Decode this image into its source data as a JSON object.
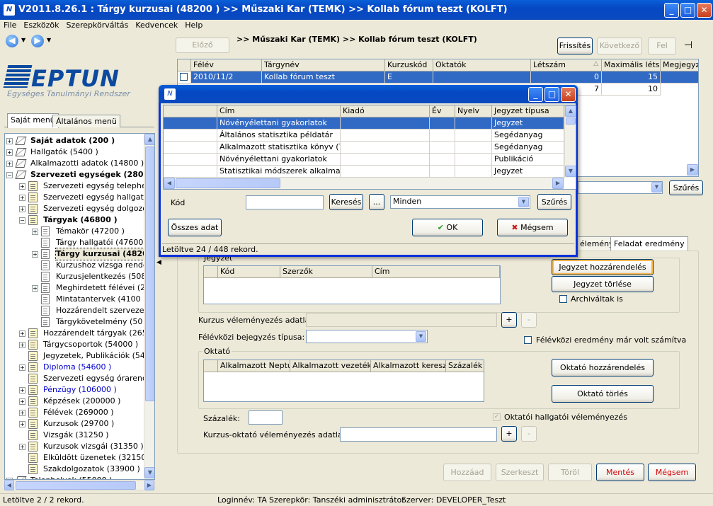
{
  "window": {
    "title": "V2011.8.26.1 : Tárgy kurzusai (48200  )  >> Műszaki Kar (TEMK) >> Kollab fórum teszt (KOLFT)",
    "min": "_",
    "max": "□",
    "close": "✕"
  },
  "menu": [
    "File",
    "Eszközök",
    "Szerepkörváltás",
    "Kedvencek",
    "Help"
  ],
  "logo": {
    "name": "NEPTUN",
    "subtitle": "Egységes Tanulmányi Rendszer"
  },
  "left_tabs": [
    "Saját menü",
    "Általános menü"
  ],
  "tree": [
    {
      "label": "Saját adatok (200  )",
      "bold": true,
      "level": 0,
      "sign": "+",
      "icon": "book"
    },
    {
      "label": "Hallgatók (5400  )",
      "level": 0,
      "sign": "+",
      "icon": "book"
    },
    {
      "label": "Alkalmazotti adatok (14800  )",
      "level": 0,
      "sign": "+",
      "icon": "book"
    },
    {
      "label": "Szervezeti egységek (28000",
      "bold": true,
      "level": 0,
      "sign": "-",
      "icon": "book"
    },
    {
      "label": "Szervezeti egység telephelyei",
      "level": 1,
      "sign": "+",
      "icon": "docs"
    },
    {
      "label": "Szervezeti egység hallgatói (2",
      "level": 1,
      "sign": "+",
      "icon": "docs"
    },
    {
      "label": "Szervezeti egység dolgozói (2",
      "level": 1,
      "sign": "+",
      "icon": "docs"
    },
    {
      "label": "Tárgyak (46800  )",
      "bold": true,
      "level": 1,
      "sign": "-",
      "icon": "docs"
    },
    {
      "label": "Témakör (47200  )",
      "level": 2,
      "sign": "+",
      "icon": "doc"
    },
    {
      "label": "Tárgy hallgatói (47600  )",
      "level": 2,
      "sign": "",
      "icon": "doc"
    },
    {
      "label": "Tárgy kurzusai (4820",
      "bold": true,
      "level": 2,
      "sign": "+",
      "icon": "doc"
    },
    {
      "label": "Kurzushoz vizsga rendelé",
      "level": 2,
      "sign": "",
      "icon": "doc"
    },
    {
      "label": "Kurzusjelentkezés (50800",
      "level": 2,
      "sign": "",
      "icon": "doc"
    },
    {
      "label": "Meghirdetett félévei (2684",
      "level": 2,
      "sign": "+",
      "icon": "doc"
    },
    {
      "label": "Mintatantervek (4100  )",
      "level": 2,
      "sign": "",
      "icon": "doc"
    },
    {
      "label": "Hozzárendelt szervezeti e",
      "level": 2,
      "sign": "",
      "icon": "doc"
    },
    {
      "label": "Tárgykövetelmény (50",
      "level": 2,
      "sign": "",
      "icon": "doc"
    },
    {
      "label": "Hozzárendelt tárgyak (2650  )",
      "level": 1,
      "sign": "+",
      "icon": "docs"
    },
    {
      "label": "Tárgycsoportok (54000  )",
      "level": 1,
      "sign": "+",
      "icon": "docs"
    },
    {
      "label": "Jegyzetek, Publikációk (5440",
      "level": 1,
      "sign": "",
      "icon": "docs"
    },
    {
      "label": "Diploma (54600  )",
      "level": 1,
      "sign": "+",
      "icon": "docs",
      "blue": true
    },
    {
      "label": "Szervezeti egység órarendje (",
      "level": 1,
      "sign": "",
      "icon": "docs"
    },
    {
      "label": "Pénzügy (106000  )",
      "level": 1,
      "sign": "+",
      "icon": "docs",
      "blue": true
    },
    {
      "label": "Képzések (200000  )",
      "level": 1,
      "sign": "+",
      "icon": "docs"
    },
    {
      "label": "Félévek (269000  )",
      "level": 1,
      "sign": "+",
      "icon": "docs"
    },
    {
      "label": "Kurzusok (29700  )",
      "level": 1,
      "sign": "+",
      "icon": "docs"
    },
    {
      "label": "Vizsgák (31250  )",
      "level": 1,
      "sign": "",
      "icon": "docs"
    },
    {
      "label": "Kurzusok vizsgái (31350  )",
      "level": 1,
      "sign": "+",
      "icon": "docs"
    },
    {
      "label": "Elküldött üzenetek (32150  )",
      "level": 1,
      "sign": "",
      "icon": "docs"
    },
    {
      "label": "Szakdolgozatok (33900  )",
      "level": 1,
      "sign": "",
      "icon": "docs"
    },
    {
      "label": "Telephelyek (55000  )",
      "level": 0,
      "sign": "+",
      "icon": "book"
    }
  ],
  "toolbar": {
    "prev": "Előző",
    "breadcrumb": ">> Műszaki Kar (TEMK) >> Kollab fórum teszt (KOLFT)",
    "refresh": "Frissítés",
    "next": "Következő",
    "up": "Fel",
    "pin": "⊣"
  },
  "main_grid": {
    "columns": [
      "Félév",
      "Tárgynév",
      "Kurzuskód",
      "Oktatók",
      "Létszám",
      "Maximális létsz...",
      "Megjegyzé"
    ],
    "rows": [
      [
        "2010/11/2",
        "Kollab fórum teszt",
        "E",
        "",
        "0",
        "15",
        ""
      ],
      [
        "",
        "",
        "",
        "",
        "7",
        "10",
        ""
      ]
    ]
  },
  "right_filter": {
    "filter_btn": "Szűrés"
  },
  "detail_tabs": [
    "éleménylista",
    "Feladat eredmény"
  ],
  "detail": {
    "jegyzet_group": "Jegyzet",
    "jegyzet_columns": [
      "Kód",
      "Szerzők",
      "Cím"
    ],
    "assign_note": "Jegyzet hozzárendelés",
    "delete_note": "Jegyzet törlése",
    "archived": "Archiváltak is",
    "course_eval_label": "Kurzus véleményezés adatlapja:",
    "plus": "+",
    "minus": "-",
    "midterm_label": "Félévközi bejegyzés típusa:",
    "midterm_calculated": "Félévközi eredmény már volt számítva",
    "teacher_group": "Oktató",
    "teacher_columns": [
      "Alkalmazott Neptu...",
      "Alkalmazott vezeték...",
      "Alkalmazott kereszt...",
      "Százalék"
    ],
    "assign_teacher": "Oktató hozzárendelés",
    "delete_teacher": "Oktató törlés",
    "percent_label": "Százalék:",
    "student_eval": "Oktatói hallgatói véleményezés",
    "course_teacher_eval_label": "Kurzus-oktató véleményezés adatlapja:"
  },
  "bottom_buttons": {
    "add": "Hozzáad",
    "edit": "Szerkeszt",
    "delete": "Töröl",
    "save": "Mentés",
    "cancel": "Mégsem"
  },
  "status": {
    "left": "Letöltve 2 / 2 rekord.",
    "login": "Loginnév: TA",
    "role": "Szerepkör: Tanszéki adminisztrátor",
    "server": "Szerver: DEVELOPER_Teszt"
  },
  "dialog": {
    "columns": [
      "Cím",
      "Kiadó",
      "Év",
      "Nyelv",
      "Jegyzet típusa"
    ],
    "rows": [
      [
        "Növényélettani gyakorlatok",
        "",
        "",
        "",
        "Jegyzet"
      ],
      [
        "Általános statisztika példatár",
        "",
        "",
        "",
        "Segédanyag"
      ],
      [
        "Alkalmazott statisztika könyv (Talent",
        "",
        "",
        "",
        "Segédanyag"
      ],
      [
        "Növényélettani gyakorlatok",
        "",
        "",
        "",
        "Publikáció"
      ],
      [
        "Statisztikai módszerek alkalmazása",
        "",
        "",
        "",
        "Jegyzet"
      ]
    ],
    "code_label": "Kód",
    "search_btn": "Keresés",
    "dots_btn": "...",
    "filter_value": "Minden",
    "filter_btn": "Szűrés",
    "all_data": "Összes adat",
    "ok": "OK",
    "cancel": "Mégsem",
    "status": "Letöltve 24 / 448 rekord."
  },
  "colors": {
    "titlebar": "#0548c3",
    "selection": "#316ac5",
    "red_text": "#d00000",
    "tree_link": "#0000cc"
  }
}
